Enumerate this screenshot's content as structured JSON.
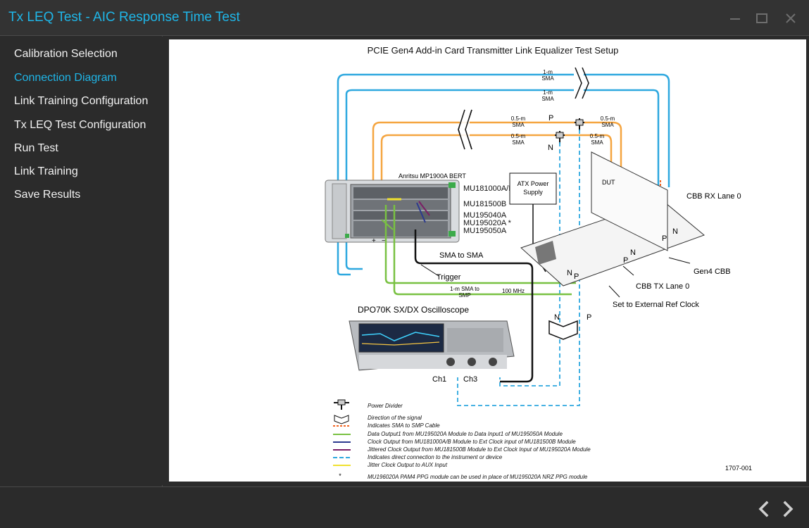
{
  "window": {
    "title": "Tx LEQ Test - AIC Response Time Test"
  },
  "sidebar": {
    "items": [
      {
        "label": "Calibration Selection",
        "active": false
      },
      {
        "label": "Connection Diagram",
        "active": true
      },
      {
        "label": "Link Training Configuration",
        "active": false
      },
      {
        "label": "Tx LEQ Test Configuration",
        "active": false
      },
      {
        "label": "Run Test",
        "active": false
      },
      {
        "label": "Link Training",
        "active": false
      },
      {
        "label": "Save Results",
        "active": false
      }
    ]
  },
  "colors": {
    "accent": "#1fb6e8",
    "background": "#2b2b2b",
    "text": "#f2f2f2",
    "cable_blue": "#2ea8df",
    "cable_orange": "#f5a540",
    "cable_green": "#79c142"
  },
  "diagram": {
    "title": "PCIE Gen4 Add-in Card Transmitter Link Equalizer Test Setup",
    "bert_label": "Anritsu MP1900A BERT",
    "modules": [
      "MU181000A/B",
      "MU181500B",
      "MU195040A",
      "MU195020A *",
      "MU195050A"
    ],
    "cable_1m_sma_a": [
      "1-m",
      "SMA"
    ],
    "cable_1m_sma_b": [
      "1-m",
      "SMA"
    ],
    "cable_05m_1": [
      "0.5-m",
      "SMA"
    ],
    "cable_05m_2": [
      "0.5-m",
      "SMA"
    ],
    "cable_05m_3": [
      "0.5-m",
      "SMA"
    ],
    "cable_05m_4": [
      "0.5-m",
      "SMA"
    ],
    "atx": [
      "ATX Power",
      "Supply"
    ],
    "dut": "DUT",
    "cbb_rx": "CBB RX Lane 0",
    "cbb_tx": "CBB TX Lane 0",
    "gen4_cbb": "Gen4 CBB",
    "ext_ref": "Set to External Ref Clock",
    "sma_to_sma": "SMA to SMA",
    "trigger": "Trigger",
    "sma_to_smp": [
      "1-m SMA to",
      "SMP"
    ],
    "freq": "100 MHz",
    "scope": "DPO70K SX/DX Oscilloscope",
    "ch1": "Ch1",
    "ch3": "Ch3",
    "p": "P",
    "n": "N",
    "plus": "+",
    "minus": "−",
    "doc_id": "1707-001",
    "legend": [
      "Power Divider",
      "Direction of the signal",
      "Indicates SMA to SMP Cable",
      "Data Output1 from MU195020A Module to Data Input1 of MU195050A Module",
      "Clock Output from MU181000A/B Module to Ext Clock input of MU181500B Module",
      "Jittered Clock Output from MU181500B Module to Ext Clock Input of MU195020A Module",
      "Indicates direct connection to the instrument or device",
      "Jitter Clock Output to AUX Input",
      "MU196020A PAM4 PPG module can be used in place of MU195020A NRZ PPG module"
    ],
    "legend_star": "*"
  },
  "footer": {
    "prev_icon": "chevron-left-icon",
    "next_icon": "chevron-right-icon"
  }
}
